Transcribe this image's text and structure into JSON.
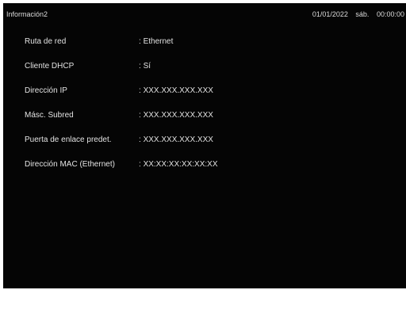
{
  "header": {
    "title": "Información2",
    "date": "01/01/2022",
    "weekday": "sáb.",
    "time": "00:00:00"
  },
  "info_rows": [
    {
      "label": "Ruta de red",
      "value": "Ethernet"
    },
    {
      "label": "Cliente DHCP",
      "value": "Sí"
    },
    {
      "label": "Dirección IP",
      "value": "XXX.XXX.XXX.XXX"
    },
    {
      "label": "Másc. Subred",
      "value": "XXX.XXX.XXX.XXX"
    },
    {
      "label": "Puerta de enlace predet.",
      "value": "XXX.XXX.XXX.XXX"
    },
    {
      "label": "Dirección MAC (Ethernet)",
      "value": "XX:XX:XX:XX:XX:XX"
    }
  ],
  "colors": {
    "background": "#050505",
    "text": "#e6e6e6",
    "page": "#ffffff"
  }
}
